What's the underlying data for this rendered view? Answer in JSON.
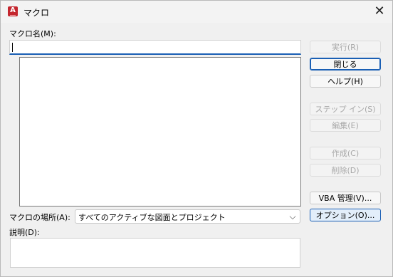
{
  "window": {
    "title": "マクロ",
    "app_icon_letter": "A",
    "close_glyph": "✕"
  },
  "form": {
    "macro_name_label": "マクロ名(M):",
    "macro_name_value": "",
    "location_label": "マクロの場所(A):",
    "location_value": "すべてのアクティブな図面とプロジェクト",
    "description_label": "説明(D):",
    "description_value": ""
  },
  "buttons": {
    "run": "実行(R)",
    "close": "閉じる",
    "help": "ヘルプ(H)",
    "step_in": "ステップ イン(S)",
    "edit": "編集(E)",
    "create": "作成(C)",
    "delete": "削除(D)",
    "vba_manager": "VBA 管理(V)...",
    "options": "オプション(O)..."
  },
  "macro_list": {
    "items": []
  },
  "colors": {
    "accent": "#1a5fb4",
    "app_icon": "#c4262e",
    "disabled_text": "#a8a8a8"
  }
}
